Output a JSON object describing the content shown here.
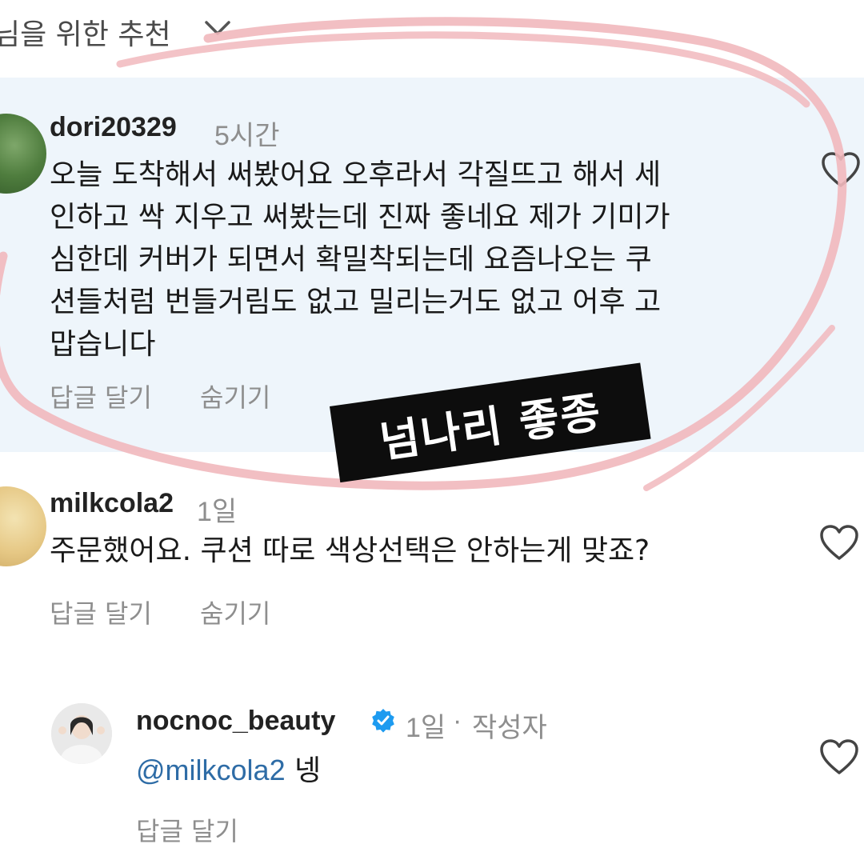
{
  "header": {
    "filter_label": "님을 위한 추천",
    "chevron_icon": "chevron-down-icon"
  },
  "comments": [
    {
      "username": "dori20329",
      "time": "5시간",
      "lines": [
        "오늘 도착해서 써봤어요 오후라서 각질뜨고 해서 세",
        "인하고 싹 지우고 써봤는데 진짜 좋네요 제가 기미가",
        "심한데 커버가 되면서 확밀착되는데 요즘나오는 쿠",
        "션들처럼 번들거림도 없고 밀리는거도 없고 어후 고",
        "맙습니다"
      ],
      "reply_label": "답글 달기",
      "hide_label": "숨기기",
      "like_icon": "heart-icon",
      "highlighted": true
    },
    {
      "username": "milkcola2",
      "time": "1일",
      "text": "주문했어요. 쿠션 따로 색상선택은 안하는게 맞죠?",
      "reply_label": "답글 달기",
      "hide_label": "숨기기",
      "like_icon": "heart-icon"
    }
  ],
  "reply": {
    "username": "nocnoc_beauty",
    "verified_icon": "verified-badge-icon",
    "time": "1일",
    "separator": "·",
    "author_label": "작성자",
    "mention": "@milkcola2",
    "text": "넹",
    "reply_label": "답글 달기",
    "like_icon": "heart-icon"
  },
  "overlay": {
    "sticker_text": "넘나리 좋종",
    "annotation": "pink-circle-annotation",
    "colors": {
      "sticker_bg": "#0d0d0d",
      "circle": "#f1b8bd",
      "highlight_bg": "#eef5fb",
      "mention": "#2e6ca6",
      "verified": "#1d9bf0"
    }
  }
}
